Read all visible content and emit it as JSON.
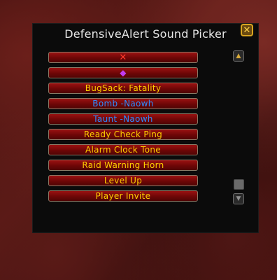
{
  "window": {
    "title": "DefensiveAlert Sound Picker",
    "close_icon": "close-x-icon"
  },
  "sounds": [
    {
      "label": "",
      "icon": "red-x-icon",
      "color": "#ff3a2a"
    },
    {
      "label": "",
      "icon": "purple-gem-icon",
      "color": "#c23cf0"
    },
    {
      "label": "BugSack: Fatality",
      "color": "#ffd100"
    },
    {
      "label": "Bomb -Naowh",
      "color": "#2f8cff"
    },
    {
      "label": "Taunt -Naowh",
      "color": "#2f8cff"
    },
    {
      "label": "Ready Check Ping",
      "color": "#ffd100"
    },
    {
      "label": "Alarm Clock Tone",
      "color": "#ffd100"
    },
    {
      "label": "Raid Warning Horn",
      "color": "#ffd100"
    },
    {
      "label": "Level Up",
      "color": "#ffd100"
    },
    {
      "label": "Player Invite",
      "color": "#ffd100"
    }
  ],
  "scrollbar": {
    "up_icon": "scroll-up-icon",
    "down_icon": "scroll-down-icon"
  }
}
